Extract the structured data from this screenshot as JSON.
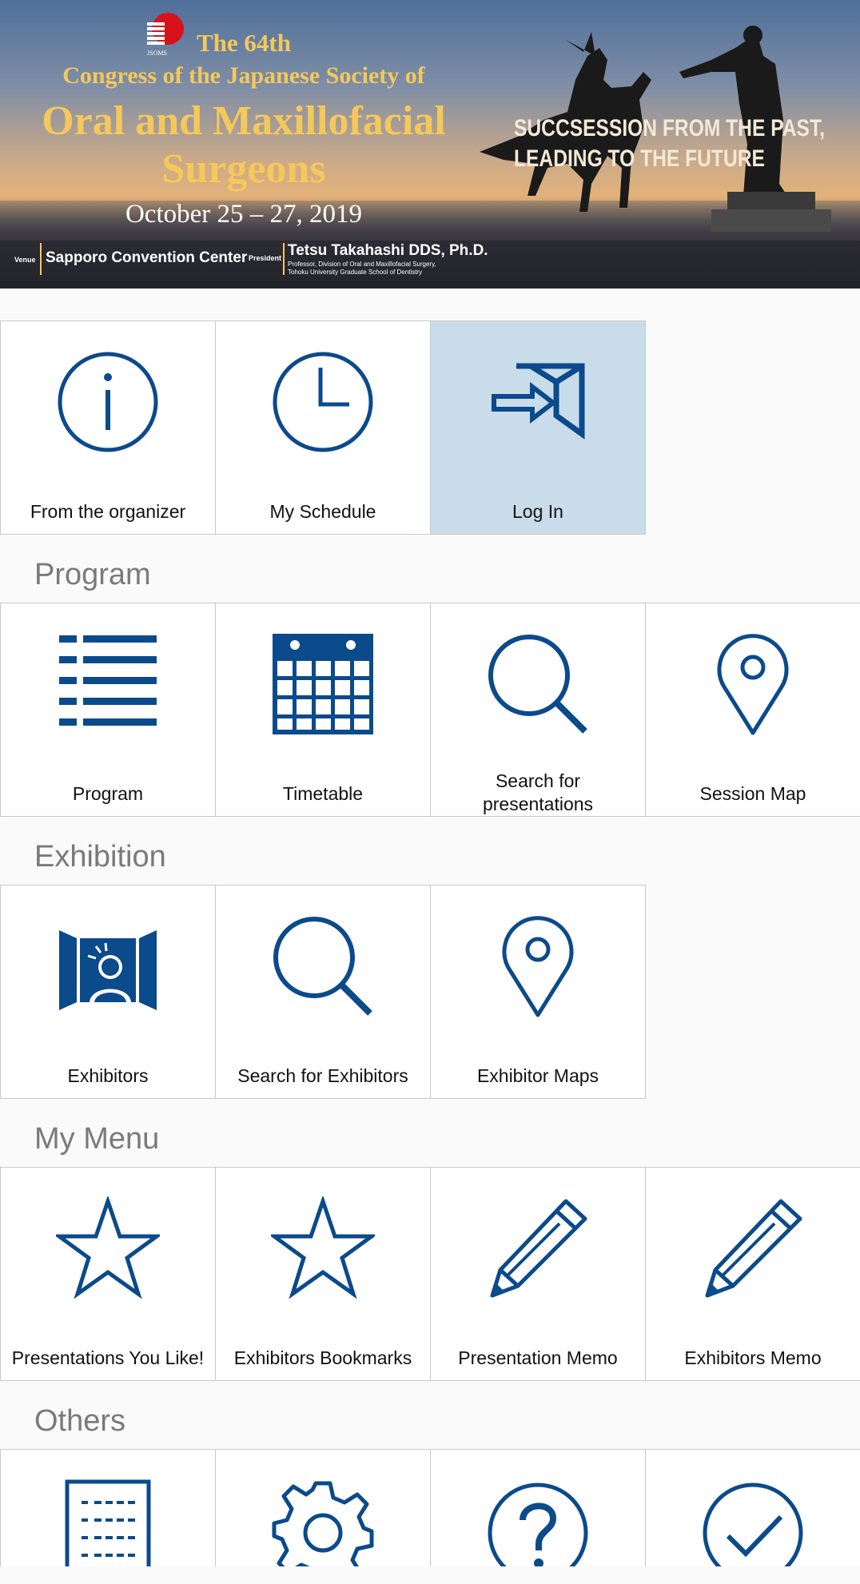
{
  "banner": {
    "logo_text": "JSOMS",
    "edition": "The 64th",
    "congress": "Congress of the Japanese Society of",
    "title_line1": "Oral and Maxillofacial",
    "title_line2": "Surgeons",
    "dates": "October 25 – 27, 2019",
    "venue_label": "Venue",
    "venue": "Sapporo Convention Center",
    "president_label": "President",
    "president": "Tetsu Takahashi DDS, Ph.D.",
    "president_aff1": "Professor, Division of Oral and Maxillofacial Surgery,",
    "president_aff2": "Tohoku University Graduate School of Dentistry",
    "slogan1": "SUCCSESSION FROM THE PAST,",
    "slogan2": "LEADING TO THE FUTURE"
  },
  "top_menu": [
    {
      "label": "From the organizer",
      "icon": "info-icon"
    },
    {
      "label": "My Schedule",
      "icon": "clock-icon"
    },
    {
      "label": "Log In",
      "icon": "login-icon",
      "selected": true
    }
  ],
  "sections": {
    "program": {
      "title": "Program",
      "items": [
        {
          "label": "Program",
          "icon": "list-icon"
        },
        {
          "label": "Timetable",
          "icon": "calendar-icon"
        },
        {
          "label": "Search for presentations",
          "icon": "search-icon"
        },
        {
          "label": "Session Map",
          "icon": "map-pin-icon"
        }
      ]
    },
    "exhibition": {
      "title": "Exhibition",
      "items": [
        {
          "label": "Exhibitors",
          "icon": "exhibitor-booth-icon"
        },
        {
          "label": "Search for Exhibitors",
          "icon": "search-icon"
        },
        {
          "label": "Exhibitor Maps",
          "icon": "map-pin-icon"
        }
      ]
    },
    "my_menu": {
      "title": "My Menu",
      "items": [
        {
          "label": "Presentations You Like!",
          "icon": "star-icon"
        },
        {
          "label": "Exhibitors Bookmarks",
          "icon": "star-icon"
        },
        {
          "label": "Presentation Memo",
          "icon": "pencil-icon"
        },
        {
          "label": "Exhibitors Memo",
          "icon": "pencil-icon"
        }
      ]
    },
    "others": {
      "title": "Others",
      "items": [
        {
          "icon": "document-list-icon"
        },
        {
          "icon": "gear-icon"
        },
        {
          "icon": "help-icon"
        },
        {
          "icon": "check-icon"
        }
      ]
    }
  },
  "colors": {
    "icon_blue": "#0b4a8b",
    "selected_bg": "#c9dcea",
    "section_title": "#7a7a7a",
    "banner_gold": "#f5c85a"
  }
}
